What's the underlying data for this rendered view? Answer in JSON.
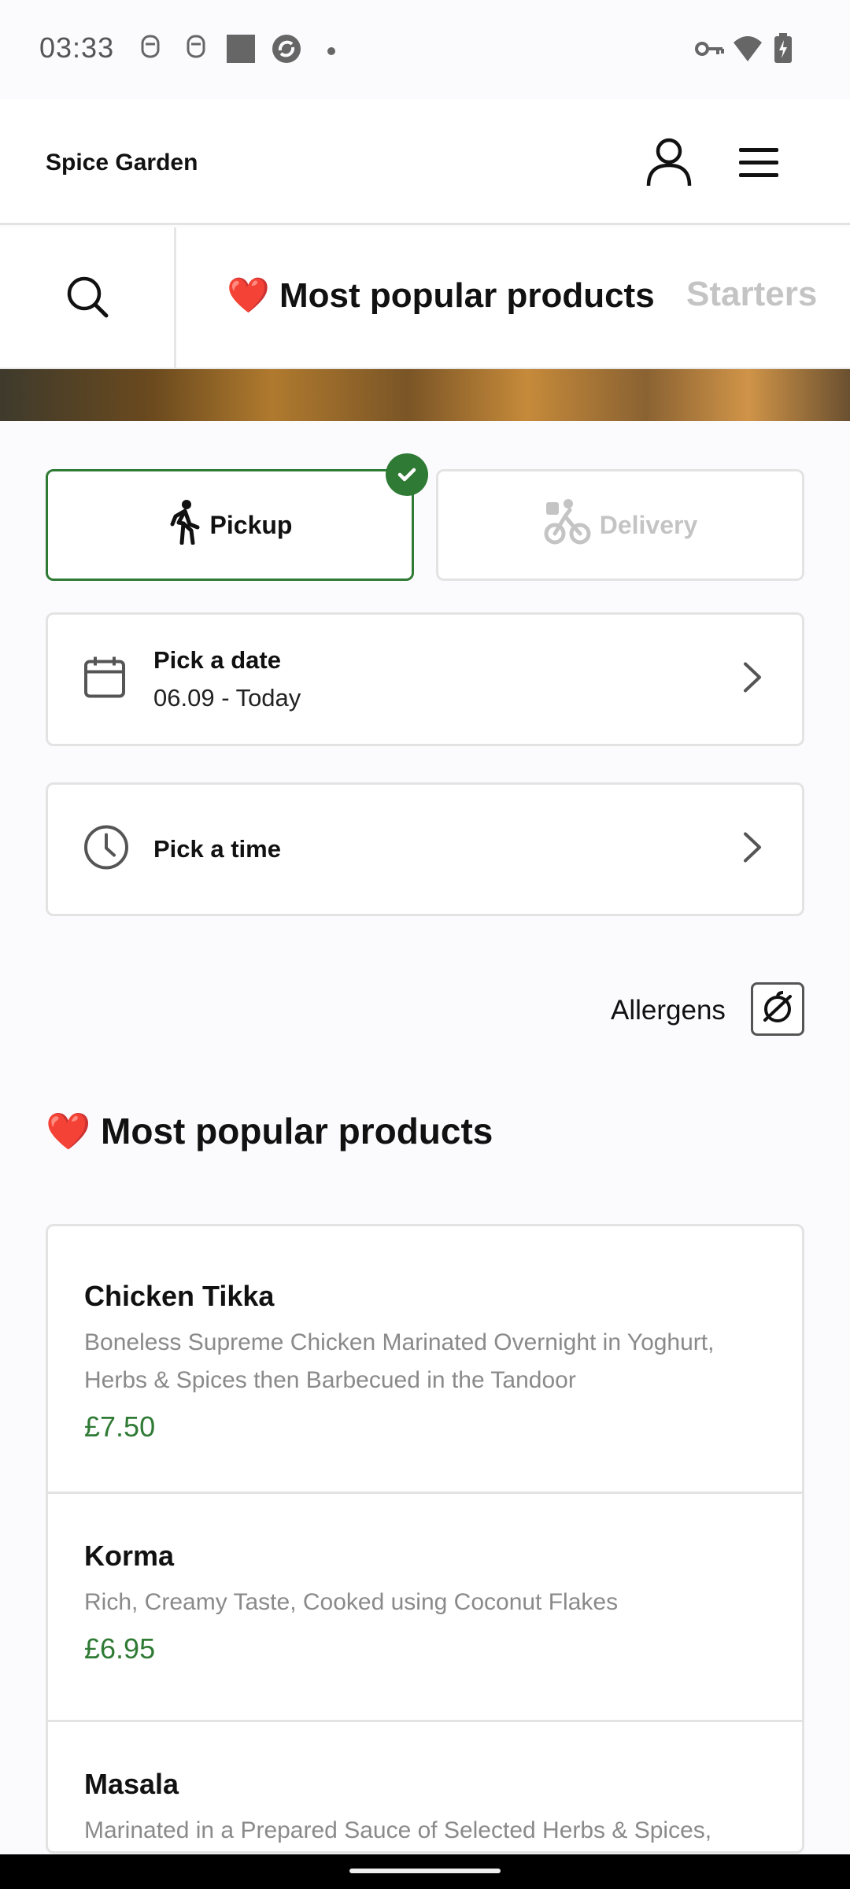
{
  "status_bar": {
    "time": "03:33",
    "left_icons": [
      "face-icon",
      "face-icon",
      "square-icon",
      "sync-icon",
      "dot-icon"
    ],
    "right_icons": [
      "key-icon",
      "wifi-icon",
      "battery-charging-icon"
    ]
  },
  "header": {
    "brand": "Spice Garden",
    "account_icon": "person-icon",
    "menu_icon": "hamburger-menu-icon"
  },
  "category_nav": {
    "search_icon": "search-icon",
    "tabs": [
      {
        "label": "❤️ Most popular products",
        "active": true
      },
      {
        "label": "Starters",
        "active": false
      }
    ]
  },
  "order_mode": {
    "options": [
      {
        "label": "Pickup",
        "icon": "walking-icon",
        "selected": true
      },
      {
        "label": "Delivery",
        "icon": "bicycle-icon",
        "selected": false
      }
    ]
  },
  "pickers": {
    "date": {
      "title": "Pick a date",
      "value": "06.09 - Today",
      "icon": "calendar-icon"
    },
    "time": {
      "title": "Pick a time",
      "icon": "clock-icon"
    }
  },
  "allergens": {
    "label": "Allergens",
    "icon": "allergen-filter-icon"
  },
  "section": {
    "title": "❤️ Most popular products"
  },
  "products": [
    {
      "name": "Chicken Tikka",
      "description": "Boneless Supreme Chicken Marinated Overnight in Yoghurt, Herbs & Spices then Barbecued in the Tandoor",
      "price": "£7.50"
    },
    {
      "name": "Korma",
      "description": "Rich, Creamy Taste, Cooked using Coconut Flakes",
      "price": "£6.95"
    },
    {
      "name": "Masala",
      "description": "Marinated in a Prepared Sauce of Selected Herbs & Spices,"
    }
  ],
  "colors": {
    "accent_green": "#2f7a34",
    "heart_red": "#d62a2a",
    "inactive_gray": "#c4c4c4"
  }
}
